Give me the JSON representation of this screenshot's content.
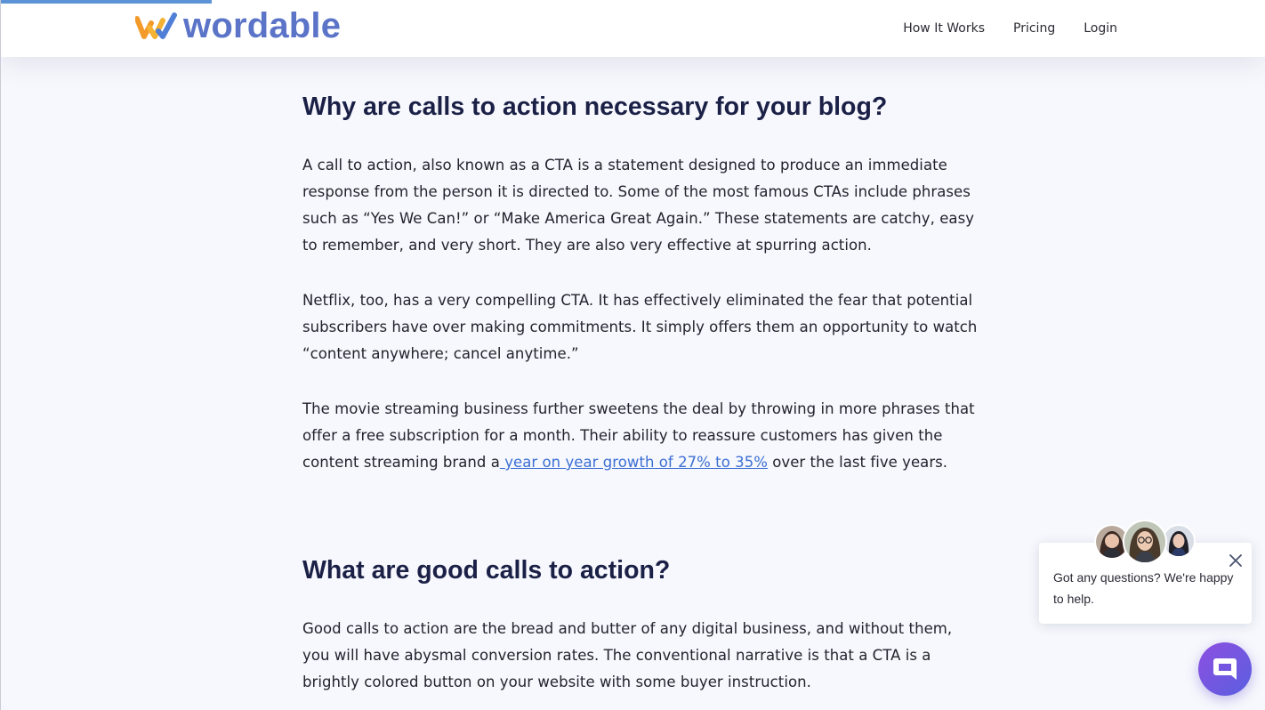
{
  "header": {
    "logo_text": "wordable",
    "logo_colors": {
      "orange": "#f39a2b",
      "blue": "#4f7fd6"
    },
    "nav": [
      {
        "label": "How It Works"
      },
      {
        "label": "Pricing"
      },
      {
        "label": "Login"
      }
    ],
    "reading_progress_color": "#5c93d6"
  },
  "article": {
    "sections": [
      {
        "heading": "Why are calls to action necessary for your blog?",
        "paragraphs": [
          "A call to action, also known as a CTA is a statement designed to produce an immediate response from the person it is directed to. Some of the most famous CTAs include phrases such as “Yes We Can!” or “Make America Great Again.” These statements are catchy, easy to remember, and very short. They are also very effective at spurring action.",
          "Netflix, too, has a very compelling CTA. It has effectively eliminated the fear that potential subscribers have over making commitments. It simply offers them an opportunity to watch “content anywhere; cancel anytime.”",
          {
            "before": "The movie streaming business further sweetens the deal by throwing in more phrases that offer a free subscription for a month. Their ability to reassure customers has given the content streaming brand a",
            "link": " year on year growth of 27% to 35%",
            "after": " over the last five years."
          }
        ]
      },
      {
        "heading": "What are good calls to action?",
        "paragraphs": [
          "Good calls to action are the bread and butter of any digital business, and without them, you will have abysmal conversion rates. The conventional narrative is that a CTA is a brightly colored button on your website with some buyer instruction."
        ]
      }
    ],
    "link_color": "#3b6fd3"
  },
  "chat_widget": {
    "message": "Got any questions? We're happy to help.",
    "close_icon": "close-icon",
    "launcher_icon": "chat-bubble-icon",
    "launcher_gradient": [
      "#8d4fe0",
      "#5a5fe0"
    ]
  }
}
